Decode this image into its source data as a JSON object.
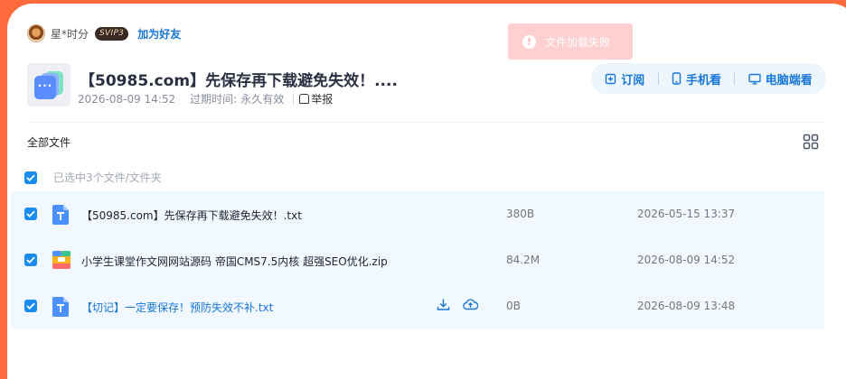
{
  "user": {
    "name": "星*时分",
    "badge": "SVIP3",
    "add_friend": "加为好友"
  },
  "toast": {
    "icon": "!",
    "message": "文件加载失败"
  },
  "share": {
    "title": "【50985.com】先保存再下载避免失效！....",
    "created": "2026-08-09 14:52",
    "expire_label": "过期时间:",
    "expire_value": "永久有效",
    "report": "举报"
  },
  "view_options": [
    {
      "label": "订阅",
      "icon": "subscribe-icon"
    },
    {
      "label": "手机看",
      "icon": "phone-icon"
    },
    {
      "label": "电脑端看",
      "icon": "monitor-icon"
    }
  ],
  "breadcrumb": "全部文件",
  "selection_text": "已选中3个文件/文件夹",
  "files": [
    {
      "name": "【50985.com】先保存再下载避免失效！.txt",
      "size": "380B",
      "date": "2026-05-15 13:37",
      "type": "txt",
      "checked": true
    },
    {
      "name": "小学生课堂作文网网站源码 帝国CMS7.5内核 超强SEO优化.zip",
      "size": "84.2M",
      "date": "2026-08-09 14:52",
      "type": "zip",
      "checked": true
    },
    {
      "name": "【切记】一定要保存！预防失效不补.txt",
      "size": "0B",
      "date": "2026-08-09 13:48",
      "type": "txt",
      "checked": true
    }
  ],
  "colors": {
    "accent": "#1677d9",
    "checkbox": "#1a8cf0",
    "page_bg": "#ff6a3d",
    "row_bg": "#f1f8ff",
    "toast_bg": "#ffd0d0"
  }
}
